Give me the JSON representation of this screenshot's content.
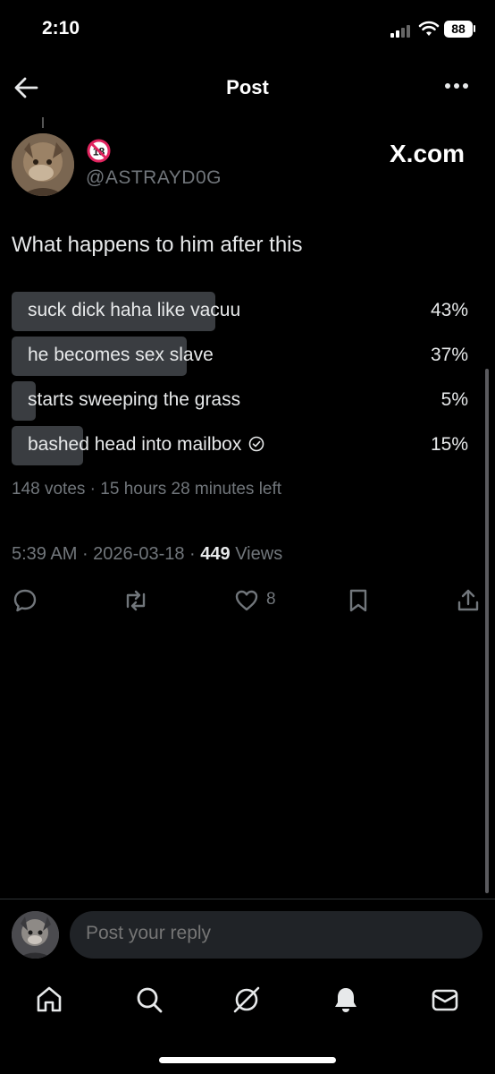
{
  "status_bar": {
    "time": "2:10",
    "battery": "88"
  },
  "header": {
    "title": "Post"
  },
  "post": {
    "source": "X.com",
    "handle": "@ASTRAYD0G",
    "text": "What happens to him after this",
    "poll": {
      "options": [
        {
          "label": "suck dick haha like vacuu",
          "percent_text": "43%",
          "percent": 43,
          "selected": false
        },
        {
          "label": "he becomes sex slave",
          "percent_text": "37%",
          "percent": 37,
          "selected": false
        },
        {
          "label": "starts sweeping the grass",
          "percent_text": "5%",
          "percent": 5,
          "selected": false
        },
        {
          "label": "bashed head into mailbox",
          "percent_text": "15%",
          "percent": 15,
          "selected": true
        }
      ],
      "summary": "148 votes · 15 hours 28 minutes left"
    },
    "time": "5:39 AM",
    "date": "2026-03-18",
    "views_count": "449",
    "views_label": "Views",
    "like_count": "8"
  },
  "reply": {
    "placeholder": "Post your reply"
  },
  "icons": {
    "back": "arrow-left-icon",
    "more": "more-icon",
    "reply": "reply-icon",
    "repost": "repost-icon",
    "like": "heart-icon",
    "bookmark": "bookmark-icon",
    "share": "share-icon",
    "nav": [
      "home-icon",
      "search-icon",
      "grok-icon",
      "notifications-icon",
      "messages-icon"
    ]
  },
  "colors": {
    "background": "#000000",
    "text": "#e7e9ea",
    "muted": "#71767b",
    "poll_bar": "#3a3d41",
    "age_badge": "#e0245e"
  }
}
